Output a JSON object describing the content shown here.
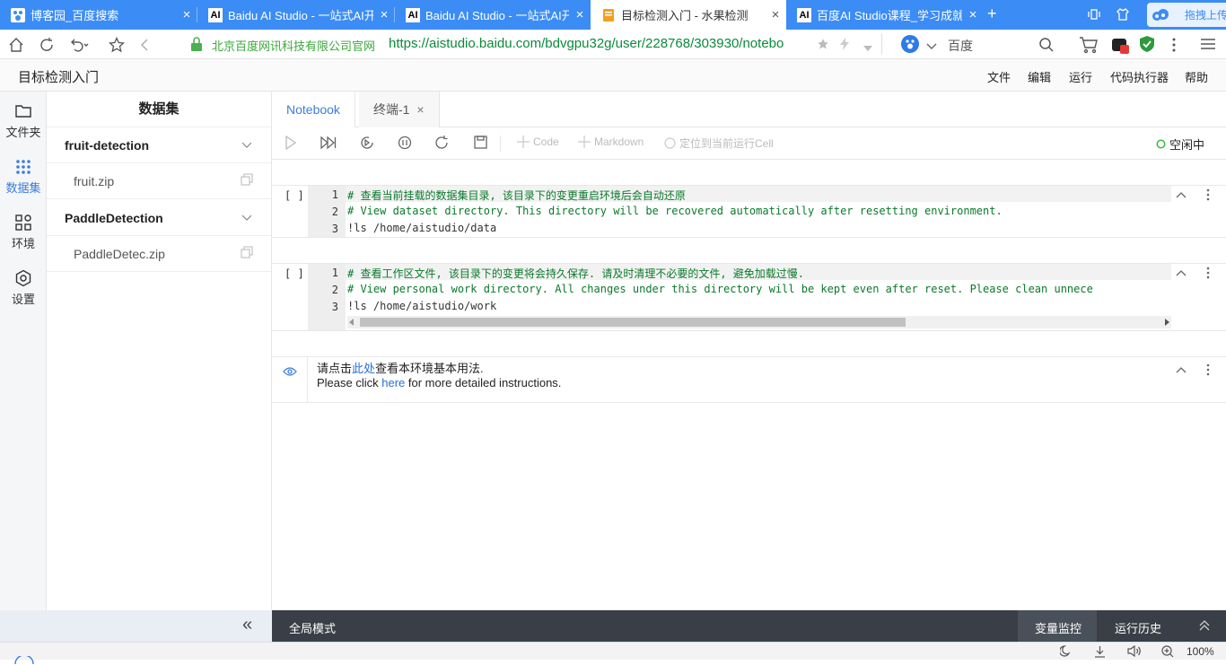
{
  "browser": {
    "tabs": [
      {
        "label": "博客园_百度搜索",
        "icon": "paw-icon"
      },
      {
        "label": "Baidu AI Studio - 一站式AI开",
        "icon": "ai-icon"
      },
      {
        "label": "Baidu AI Studio - 一站式AI开",
        "icon": "ai-icon"
      },
      {
        "label": "目标检测入门 - 水果检测",
        "icon": "notebook-icon"
      },
      {
        "label": "百度AI Studio课程_学习成就梦",
        "icon": "ai-icon"
      }
    ],
    "tab_icon_text": "AI",
    "close_glyph": "×",
    "new_tab_glyph": "+",
    "drag_tab_label": "拖拽上传",
    "site_verified": "北京百度网讯科技有限公司官网",
    "url": "https://aistudio.baidu.com/bdvgpu32g/user/228768/303930/notebo",
    "search_engine": "百度",
    "accent": "#3b8cf5"
  },
  "app": {
    "title": "目标检测入门",
    "menus": [
      "文件",
      "编辑",
      "运行",
      "代码执行器",
      "帮助"
    ]
  },
  "rail": {
    "items": [
      {
        "label": "文件夹",
        "icon": "folder-icon"
      },
      {
        "label": "数据集",
        "icon": "dataset-icon"
      },
      {
        "label": "环境",
        "icon": "environment-icon"
      },
      {
        "label": "设置",
        "icon": "settings-icon"
      }
    ]
  },
  "panel": {
    "title": "数据集",
    "groups": [
      {
        "name": "fruit-detection",
        "files": [
          "fruit.zip"
        ]
      },
      {
        "name": "PaddleDetection",
        "files": [
          "PaddleDetec.zip"
        ]
      }
    ],
    "collapse_glyph": "«"
  },
  "notebook": {
    "tabs": [
      {
        "label": "Notebook"
      },
      {
        "label": "终端-1"
      }
    ],
    "toolbar": {
      "add_code": "Code",
      "add_markdown": "Markdown",
      "locate": "定位到当前运行Cell",
      "status": "空闲中"
    },
    "cells": [
      {
        "prompt": "[ ]",
        "lines": [
          "# 查看当前挂载的数据集目录, 该目录下的变更重启环境后会自动还原",
          "# View dataset directory. This directory will be recovered automatically after resetting environment.",
          "!ls /home/aistudio/data"
        ]
      },
      {
        "prompt": "[ ]",
        "lines": [
          "# 查看工作区文件, 该目录下的变更将会持久保存. 请及时清理不必要的文件, 避免加载过慢.",
          "# View personal work directory. All changes under this directory will be kept even after reset. Please clean unnece",
          "!ls /home/aistudio/work"
        ]
      }
    ],
    "markdown": {
      "line1_before": "请点击",
      "line1_link": "此处",
      "line1_after": "查看本环境基本用法.",
      "line2_before": "Please click ",
      "line2_link": "here",
      "line2_after": " for more detailed instructions."
    },
    "line_numbers": [
      "1",
      "2",
      "3"
    ]
  },
  "bottom": {
    "mode": "全局模式",
    "var_monitor": "变量监控",
    "run_history": "运行历史"
  },
  "statusbar": {
    "zoom": "100%"
  }
}
